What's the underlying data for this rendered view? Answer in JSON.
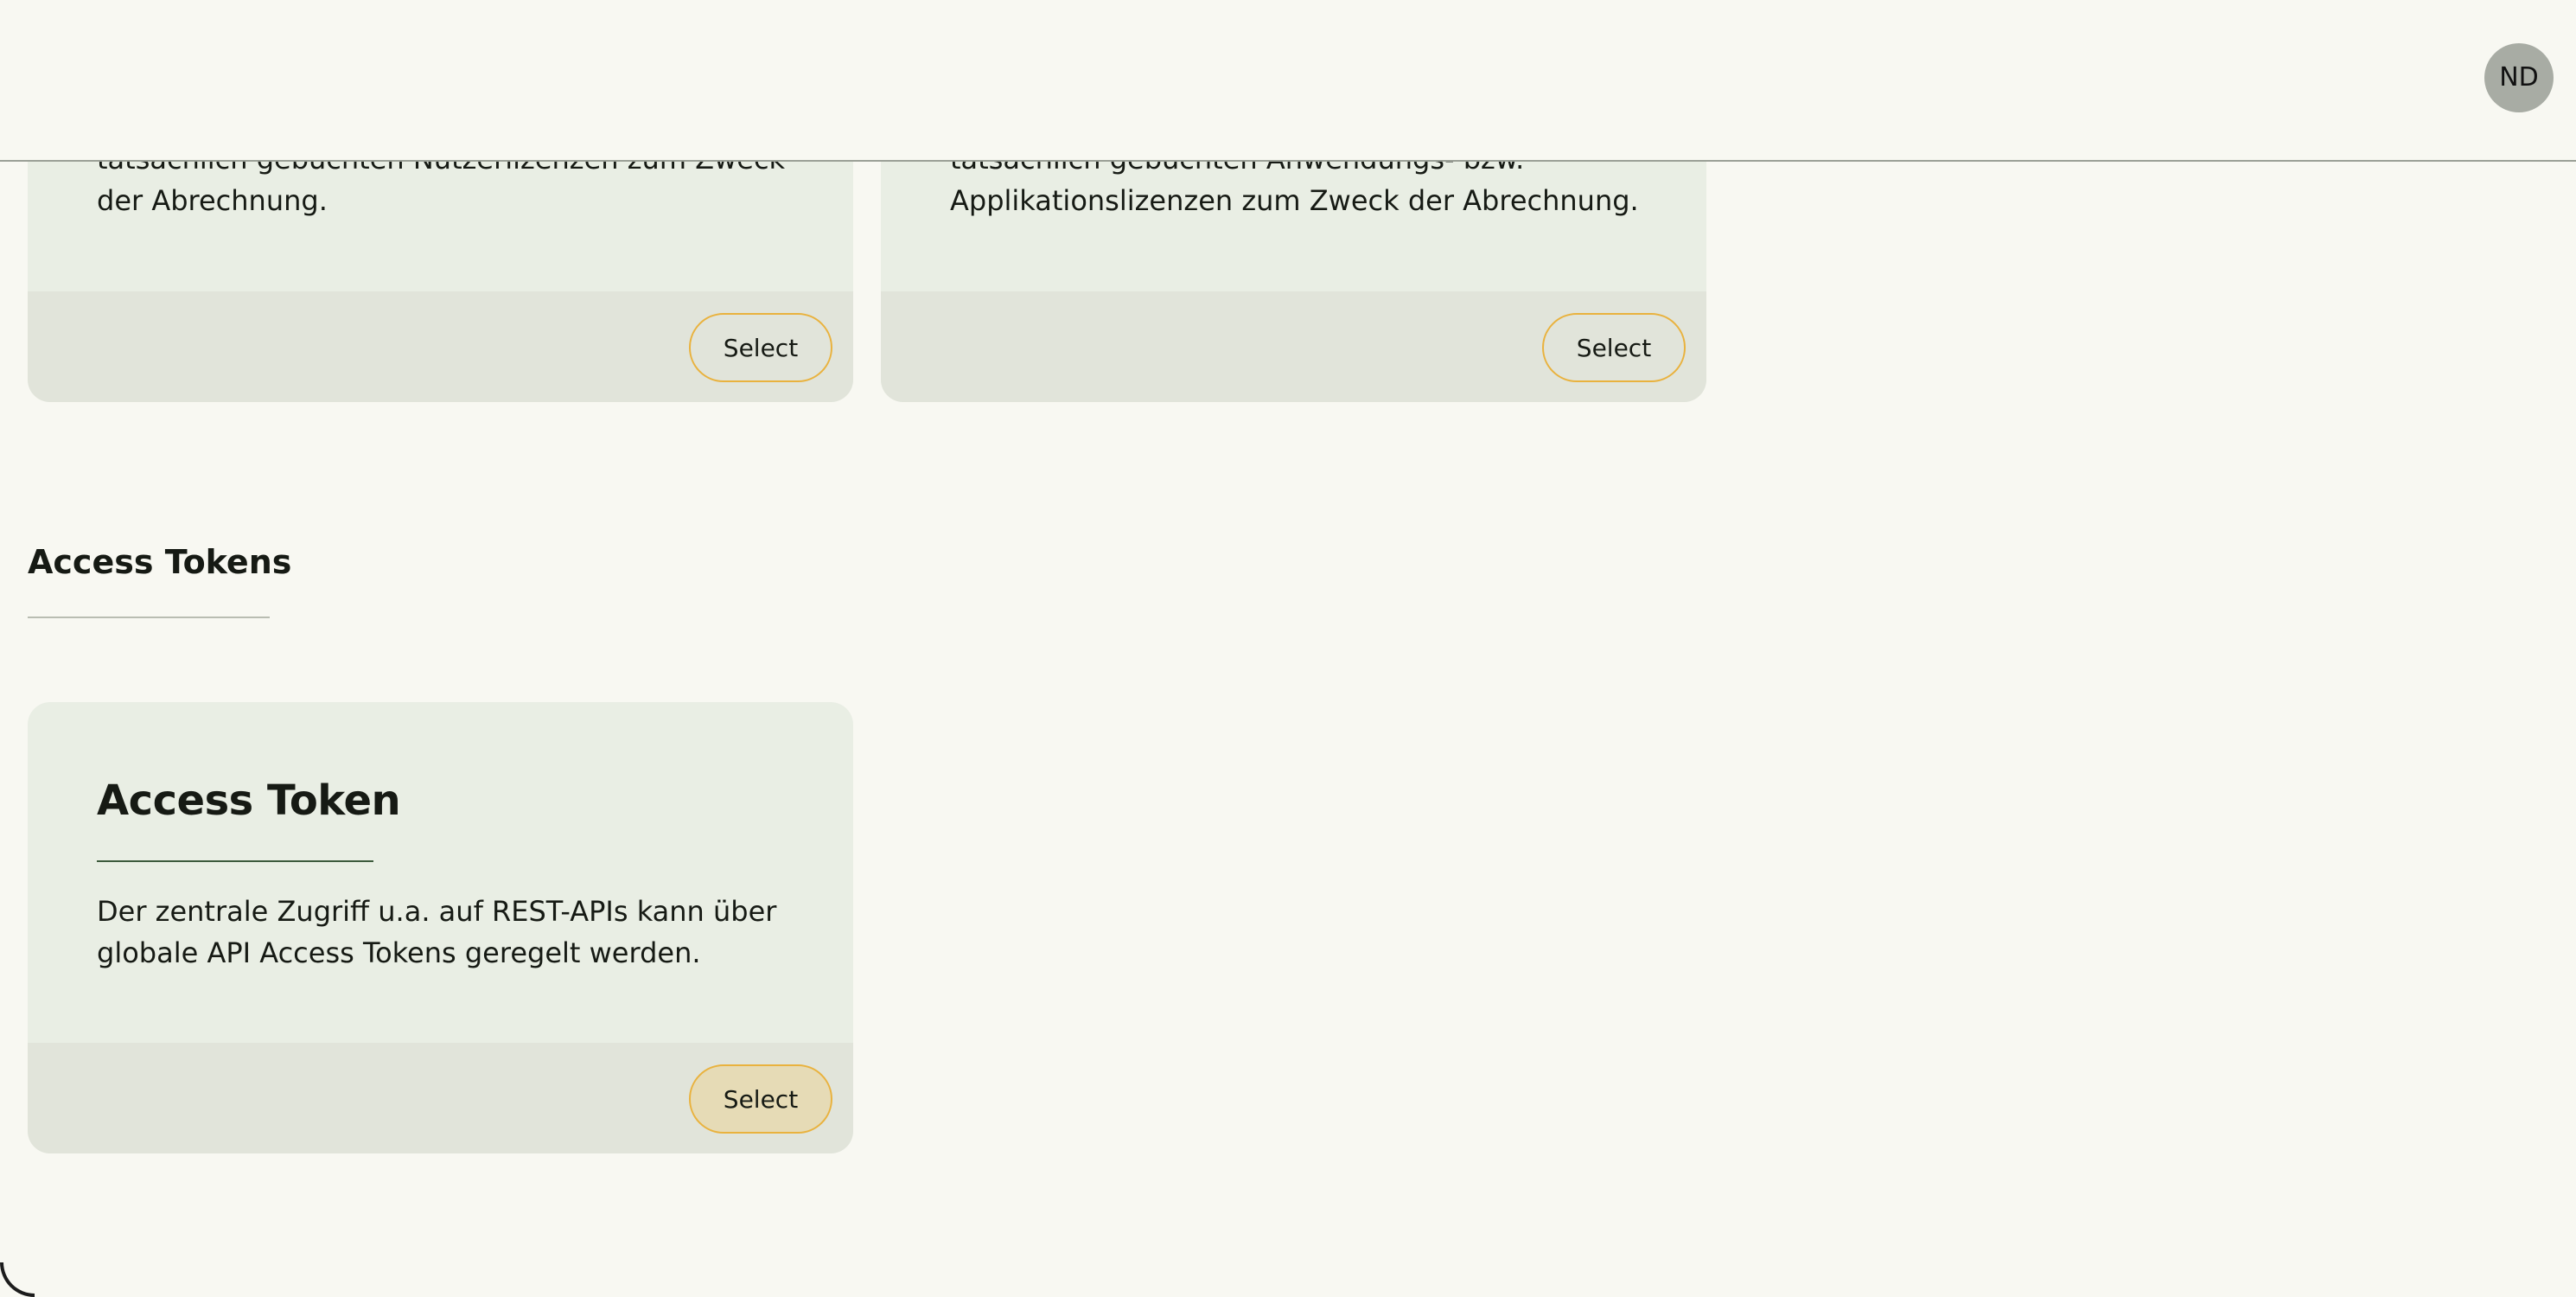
{
  "header": {
    "avatar_initials": "ND"
  },
  "cards_top": [
    {
      "text": "tatsächlich gebuchten Nutzerlizenzen zum Zweck der Abrechnung.",
      "button_label": "Select"
    },
    {
      "text": "tatsächlich gebuchten Anwendungs- bzw. Applikationslizenzen zum Zweck der Abrechnung.",
      "button_label": "Select"
    }
  ],
  "section": {
    "title": "Access Tokens"
  },
  "access_token_card": {
    "title": "Access Token",
    "text": "Der zentrale Zugriff u.a. auf REST-APIs kann über globale API Access Tokens geregelt werden.",
    "button_label": "Select"
  },
  "colors": {
    "page_background": "#f8f8f2",
    "card_background": "#e9eee4",
    "card_footer": "#e1e4da",
    "button_border": "#e9b23e",
    "button_active_fill": "#e6dbb6",
    "avatar_background": "#a8aca4"
  }
}
